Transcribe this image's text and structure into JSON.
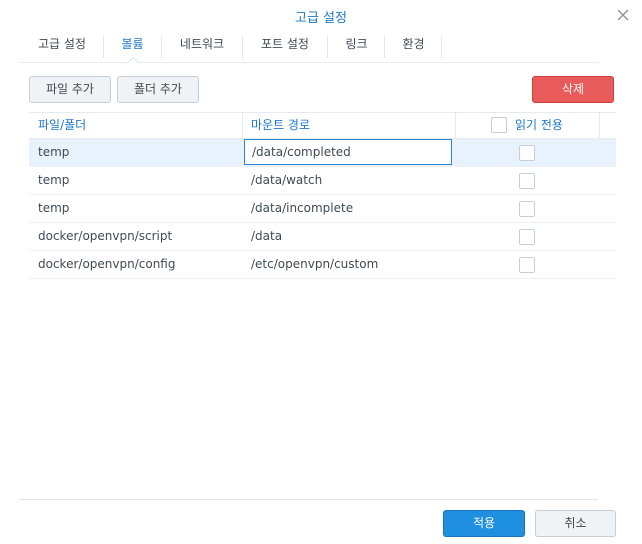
{
  "window": {
    "title": "고급 설정"
  },
  "tabs": [
    {
      "label": "고급 설정",
      "active": false
    },
    {
      "label": "볼륨",
      "active": true
    },
    {
      "label": "네트워크",
      "active": false
    },
    {
      "label": "포트 설정",
      "active": false
    },
    {
      "label": "링크",
      "active": false
    },
    {
      "label": "환경",
      "active": false
    }
  ],
  "toolbar": {
    "add_file": "파일 추가",
    "add_folder": "폴더 추가",
    "delete": "삭제"
  },
  "grid": {
    "columns": {
      "file_folder": "파일/폴더",
      "mount_path": "마운트 경로",
      "read_only": "읽기 전용"
    },
    "rows": [
      {
        "file_folder": "temp",
        "mount_path": "/data/completed",
        "read_only": false,
        "selected": true,
        "editing": true
      },
      {
        "file_folder": "temp",
        "mount_path": "/data/watch",
        "read_only": false
      },
      {
        "file_folder": "temp",
        "mount_path": "/data/incomplete",
        "read_only": false
      },
      {
        "file_folder": "docker/openvpn/script",
        "mount_path": "/data",
        "read_only": false
      },
      {
        "file_folder": "docker/openvpn/config",
        "mount_path": "/etc/openvpn/custom",
        "read_only": false
      }
    ]
  },
  "footer": {
    "apply": "적용",
    "cancel": "취소"
  },
  "colors": {
    "accent": "#1e78c8",
    "delete_button": "#e95a5a",
    "apply_button": "#1f8fe0",
    "selected_row": "#e7f2fc"
  }
}
